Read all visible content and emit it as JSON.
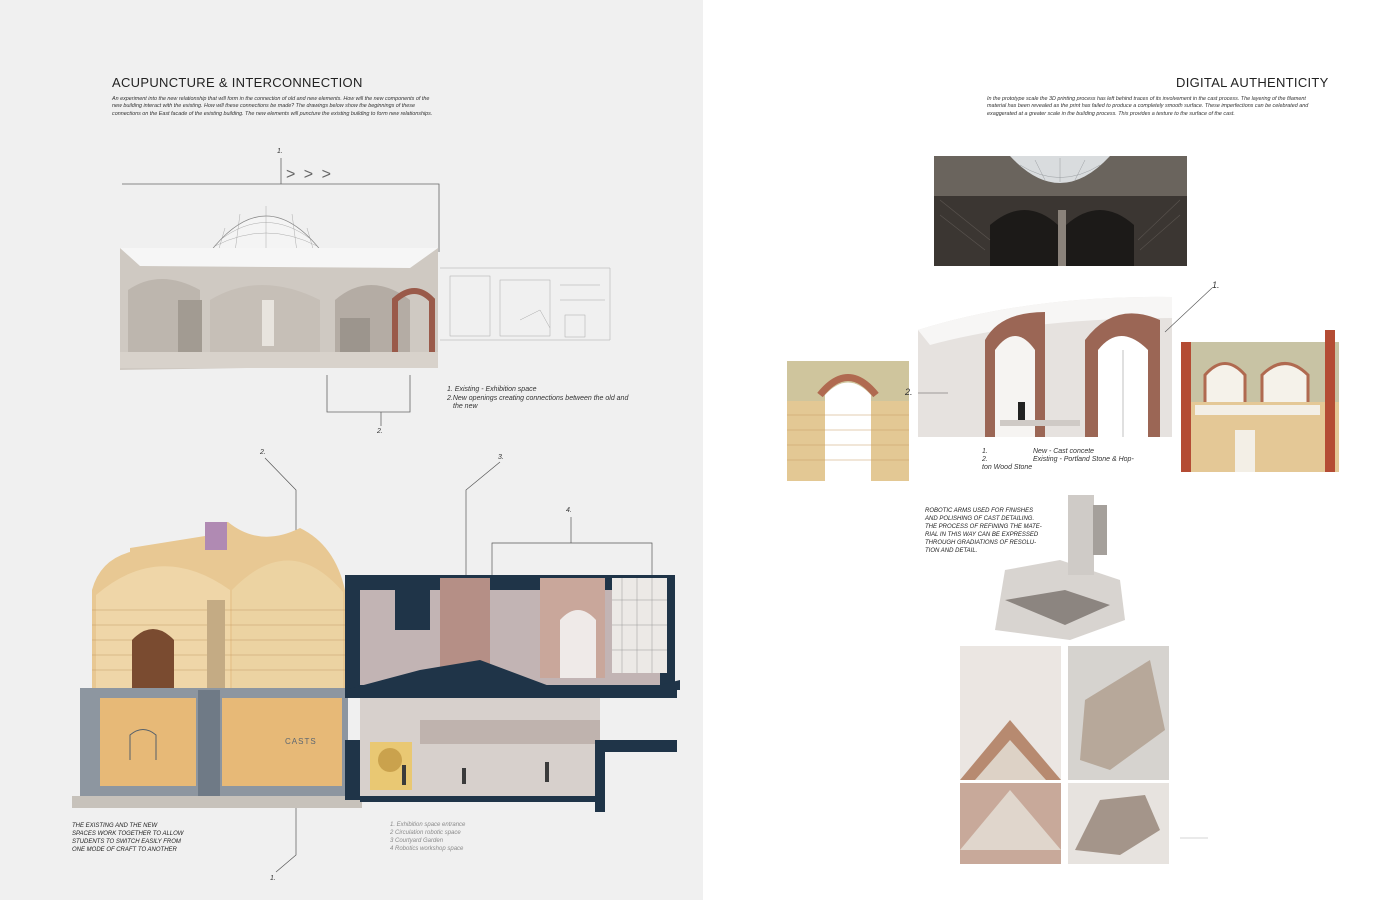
{
  "left": {
    "title": "ACUPUNCTURE & INTERCONNECTION",
    "intro": "An experiment into the new relationship that will form in the connection of old and new elements. How will the new components of the new building interact with the existing. How will these connections be made? The drawings below show the beginnings of these connections on the East facade of the existing building. The new elements will puncture the existing building to form new relationships.",
    "marker_top": "1.",
    "arrows": "> > >",
    "marker_two": "2.",
    "legend_top": [
      "1. Existing - Exhibition space",
      "2.New openings creating connections between the old and",
      "the new"
    ],
    "section_markers": [
      "2.",
      "3.",
      "4.",
      "1."
    ],
    "casts_sign": "CASTS",
    "bottom_caption": [
      "THE EXISTING AND THE NEW",
      "SPACES WORK TOGETHER TO ALLOW",
      "STUDENTS TO SWITCH EASILY FROM",
      "ONE MODE OF CRAFT TO ANOTHER"
    ],
    "bottom_legend": [
      "1. Exhibition space entrance",
      "2 Circulation robotic space",
      "3 Courtyard Garden",
      "4 Robotics workshop space"
    ]
  },
  "right": {
    "title": "DIGITAL AUTHENTICITY",
    "intro": "In the prototype scale the 3D printing process has left behind traces of its involvement in the cast process. The layering of the filament material has been revealed as the print has failed to produce a completely smooth surface. These imperfections can be celebrated and exaggerated at a greater scale in the building process. This provides a texture to the surface of the cast.",
    "marker_one": "1.",
    "marker_two": "2.",
    "legend": [
      "1.",
      "New - Cast concete",
      "2.",
      "Existing - Portland Stone & Hop-",
      "ton Wood Stone"
    ],
    "robotic_caption": [
      "ROBOTIC ARMS USED FOR FINISHES",
      "AND POLISHING OF CAST DETAILING.",
      "THE PROCESS OF REFINING THE MATE-",
      "RIAL IN THIS WAY CAN BE EXPRESSED",
      "THROUGH GRADIATIONS OF RESOLU-",
      "TION AND DETAIL."
    ]
  },
  "colors": {
    "left_bg": "#f0f0f0",
    "sandstone": "#e6c08a",
    "navy": "#1f3448",
    "brick": "#9a5a4a"
  }
}
